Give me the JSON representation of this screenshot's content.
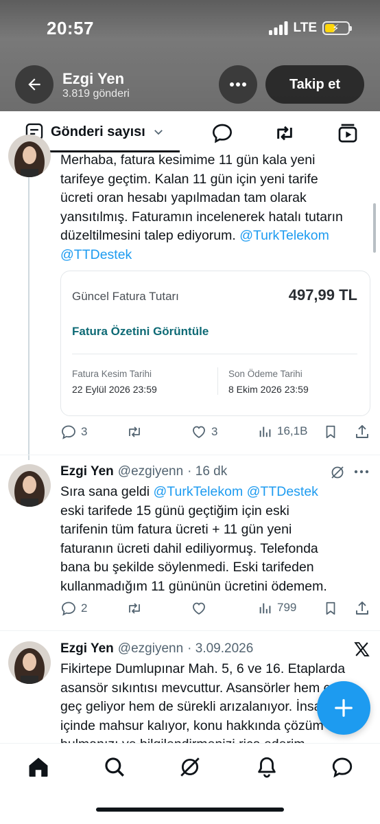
{
  "status_bar": {
    "time": "20:57",
    "network": "LTE"
  },
  "profile": {
    "name": "Ezgi Yen",
    "post_count": "3.819 gönderi",
    "follow_label": "Takip et"
  },
  "toolbar": {
    "sort_label": "Gönderi sayısı"
  },
  "tweets": [
    {
      "text_lines": [
        "Merhaba, fatura kesimime 11 gün kala yeni",
        "tarifeye geçtim. Kalan 11 gün için yeni tarife",
        "ücreti oran hesabı yapılmadan tam olarak",
        "yansıtılmış. Faturamın incelenerek hatalı tutarın"
      ],
      "last_line": "düzeltilmesini talep ediyorum. ",
      "mention_1": "@TurkTelekom",
      "mention_2": "@TTDestek",
      "card": {
        "title": "Güncel Fatura Tutarı",
        "amount": "497,99 TL",
        "link": "Fatura Özetini Görüntüle",
        "label_left": "Fatura Kesim Tarihi",
        "value_left": "22 Eylül 2026 23:59",
        "label_right": "Son Ödeme Tarihi",
        "value_right": "8 Ekim 2026 23:59"
      },
      "replies": "3",
      "likes": "3",
      "views": "16,1B"
    },
    {
      "name": "Ezgi Yen",
      "handle": "@ezgiyenn",
      "time": "· 16 dk",
      "first_line_text": "Sıra sana geldi ",
      "mention_1": "@TurkTelekom",
      "mention_2": "@TTDestek",
      "text_lines": [
        "eski tarifede 15 günü geçtiğim için eski",
        "tarifenin tüm fatura ücreti + 11 gün yeni",
        "faturanın ücreti dahil ediliyormuş. Telefonda",
        "bana bu şekilde söylenmedi. Eski tarifeden",
        "kullanmadığım 11 gününün ücretini ödemem."
      ],
      "replies": "2",
      "views": "799"
    },
    {
      "name": "Ezgi Yen",
      "handle": "@ezgiyenn",
      "time": "· 3.09.2026",
      "text_lines": [
        "Fikirtepe Dumlupınar Mah. 5, 6 ve 16. Etaplarda",
        "asansör sıkıntısı mevcuttur. Asansörler hem çok",
        "geç geliyor hem de sürekli arızalanıyor. İnsanlar",
        "içinde mahsur kalıyor, konu hakkında çözüm",
        "bulmanızı ve bilgilendirmenizi rica ederim."
      ]
    }
  ],
  "colors": {
    "accent": "#1d9bf0",
    "card_link": "#0e6a75",
    "text": "#0f1419",
    "muted": "#536471"
  },
  "icons": [
    "back-arrow-icon",
    "more-icon",
    "sort-icon",
    "chevron-down-icon",
    "spaces-icon",
    "retweet-icon",
    "video-icon",
    "reply-icon",
    "like-icon",
    "views-icon",
    "bookmark-icon",
    "share-icon",
    "grok-icon",
    "x-logo-icon",
    "compose-icon",
    "home-icon",
    "search-icon",
    "notifications-icon",
    "messages-icon"
  ]
}
